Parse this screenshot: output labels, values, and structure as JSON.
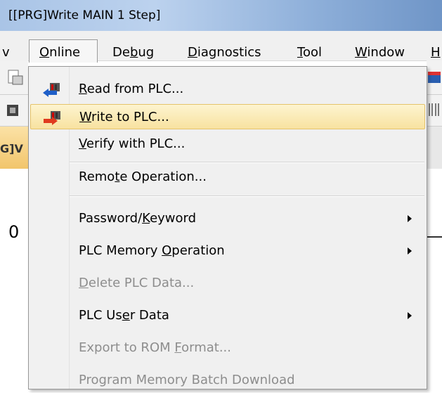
{
  "window": {
    "title": "[[PRG]Write MAIN 1 Step]"
  },
  "menubar": {
    "items": [
      {
        "pre": "",
        "ul": "",
        "post": "v"
      },
      {
        "pre": "",
        "ul": "O",
        "post": "nline"
      },
      {
        "pre": "De",
        "ul": "b",
        "post": "ug"
      },
      {
        "pre": "",
        "ul": "D",
        "post": "iagnostics"
      },
      {
        "pre": "",
        "ul": "T",
        "post": "ool"
      },
      {
        "pre": "",
        "ul": "W",
        "post": "indow"
      },
      {
        "pre": "",
        "ul": "H",
        "post": ""
      }
    ]
  },
  "editor": {
    "tab_fragment": "G]V",
    "rung_number": "0"
  },
  "menu": {
    "items": [
      {
        "pre": "",
        "ul": "R",
        "post": "ead from PLC...",
        "enabled": true,
        "submenu": false,
        "icon": "read-from-plc-icon"
      },
      {
        "pre": "",
        "ul": "W",
        "post": "rite to PLC...",
        "enabled": true,
        "submenu": false,
        "icon": "write-to-plc-icon",
        "highlighted": true
      },
      {
        "pre": "",
        "ul": "V",
        "post": "erify with PLC...",
        "enabled": true,
        "submenu": false
      },
      {
        "pre": "Remo",
        "ul": "t",
        "post": "e Operation...",
        "enabled": true,
        "submenu": false
      },
      {
        "pre": "Password/",
        "ul": "K",
        "post": "eyword",
        "enabled": true,
        "submenu": true
      },
      {
        "pre": "PLC Memory ",
        "ul": "O",
        "post": "peration",
        "enabled": true,
        "submenu": true
      },
      {
        "pre": "",
        "ul": "D",
        "post": "elete PLC Data...",
        "enabled": false,
        "submenu": false
      },
      {
        "pre": "PLC Us",
        "ul": "e",
        "post": "r Data",
        "enabled": true,
        "submenu": true
      },
      {
        "pre": "Export to ROM ",
        "ul": "F",
        "post": "ormat...",
        "enabled": false,
        "submenu": false
      },
      {
        "pre": "Program Memory Batch Download",
        "ul": "",
        "post": "",
        "enabled": false,
        "submenu": false
      }
    ]
  },
  "colors": {
    "highlight": "#f8e2a0",
    "disabled_text": "#8d8d8d",
    "accent_tab": "#f2c56b"
  }
}
